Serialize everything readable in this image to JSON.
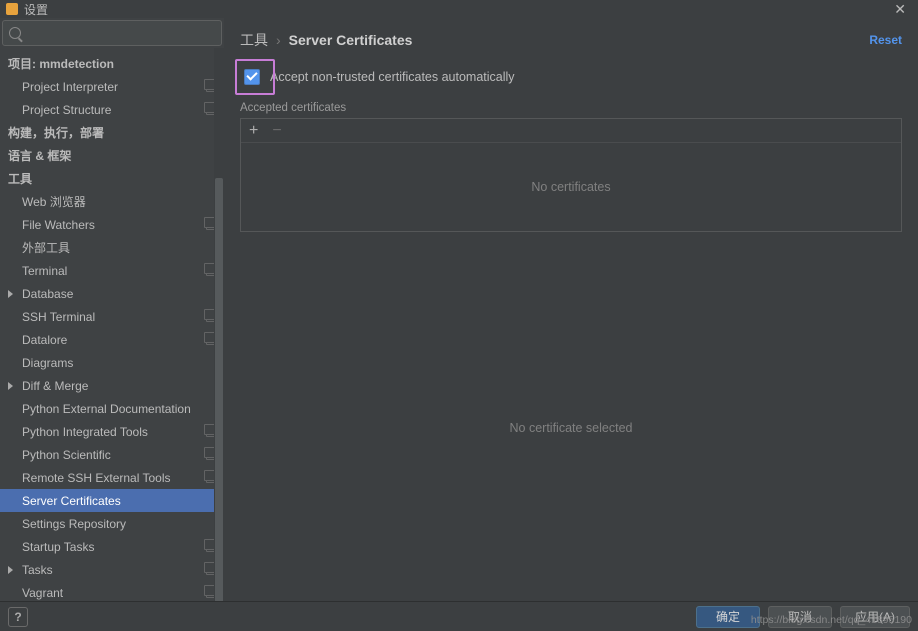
{
  "window": {
    "title": "设置"
  },
  "search": {
    "placeholder": ""
  },
  "sidebar": {
    "project_header": "项目: mmdetection",
    "project_items": [
      {
        "label": "Project Interpreter",
        "copy": true
      },
      {
        "label": "Project Structure",
        "copy": true
      }
    ],
    "build_header": "构建，执行，部署",
    "lang_header": "语言 & 框架",
    "tools_header": "工具",
    "tools_items": [
      {
        "label": "Web 浏览器",
        "arrow": false,
        "copy": false
      },
      {
        "label": "File Watchers",
        "arrow": false,
        "copy": true
      },
      {
        "label": "外部工具",
        "arrow": false,
        "copy": false
      },
      {
        "label": "Terminal",
        "arrow": false,
        "copy": true
      },
      {
        "label": "Database",
        "arrow": true,
        "copy": false
      },
      {
        "label": "SSH Terminal",
        "arrow": false,
        "copy": true
      },
      {
        "label": "Datalore",
        "arrow": false,
        "copy": true
      },
      {
        "label": "Diagrams",
        "arrow": false,
        "copy": false
      },
      {
        "label": "Diff & Merge",
        "arrow": true,
        "copy": false
      },
      {
        "label": "Python External Documentation",
        "arrow": false,
        "copy": false
      },
      {
        "label": "Python Integrated Tools",
        "arrow": false,
        "copy": true
      },
      {
        "label": "Python Scientific",
        "arrow": false,
        "copy": true
      },
      {
        "label": "Remote SSH External Tools",
        "arrow": false,
        "copy": true
      },
      {
        "label": "Server Certificates",
        "arrow": false,
        "copy": false
      },
      {
        "label": "Settings Repository",
        "arrow": false,
        "copy": false
      },
      {
        "label": "Startup Tasks",
        "arrow": false,
        "copy": true
      },
      {
        "label": "Tasks",
        "arrow": true,
        "copy": true
      },
      {
        "label": "Vagrant",
        "arrow": false,
        "copy": true
      }
    ],
    "selected_index": 13
  },
  "breadcrumb": {
    "parent": "工具",
    "current": "Server Certificates",
    "reset": "Reset"
  },
  "accept_checkbox": {
    "checked": true,
    "label": "Accept non-trusted certificates automatically"
  },
  "accepted_section_label": "Accepted certificates",
  "toolbar": {
    "add": "+",
    "remove": "−"
  },
  "empty_list": "No certificates",
  "empty_detail": "No certificate selected",
  "footer": {
    "help": "?",
    "ok": "确定",
    "cancel": "取消",
    "apply": "应用(A)"
  },
  "watermark": "https://blog.csdn.net/qq_41895190"
}
